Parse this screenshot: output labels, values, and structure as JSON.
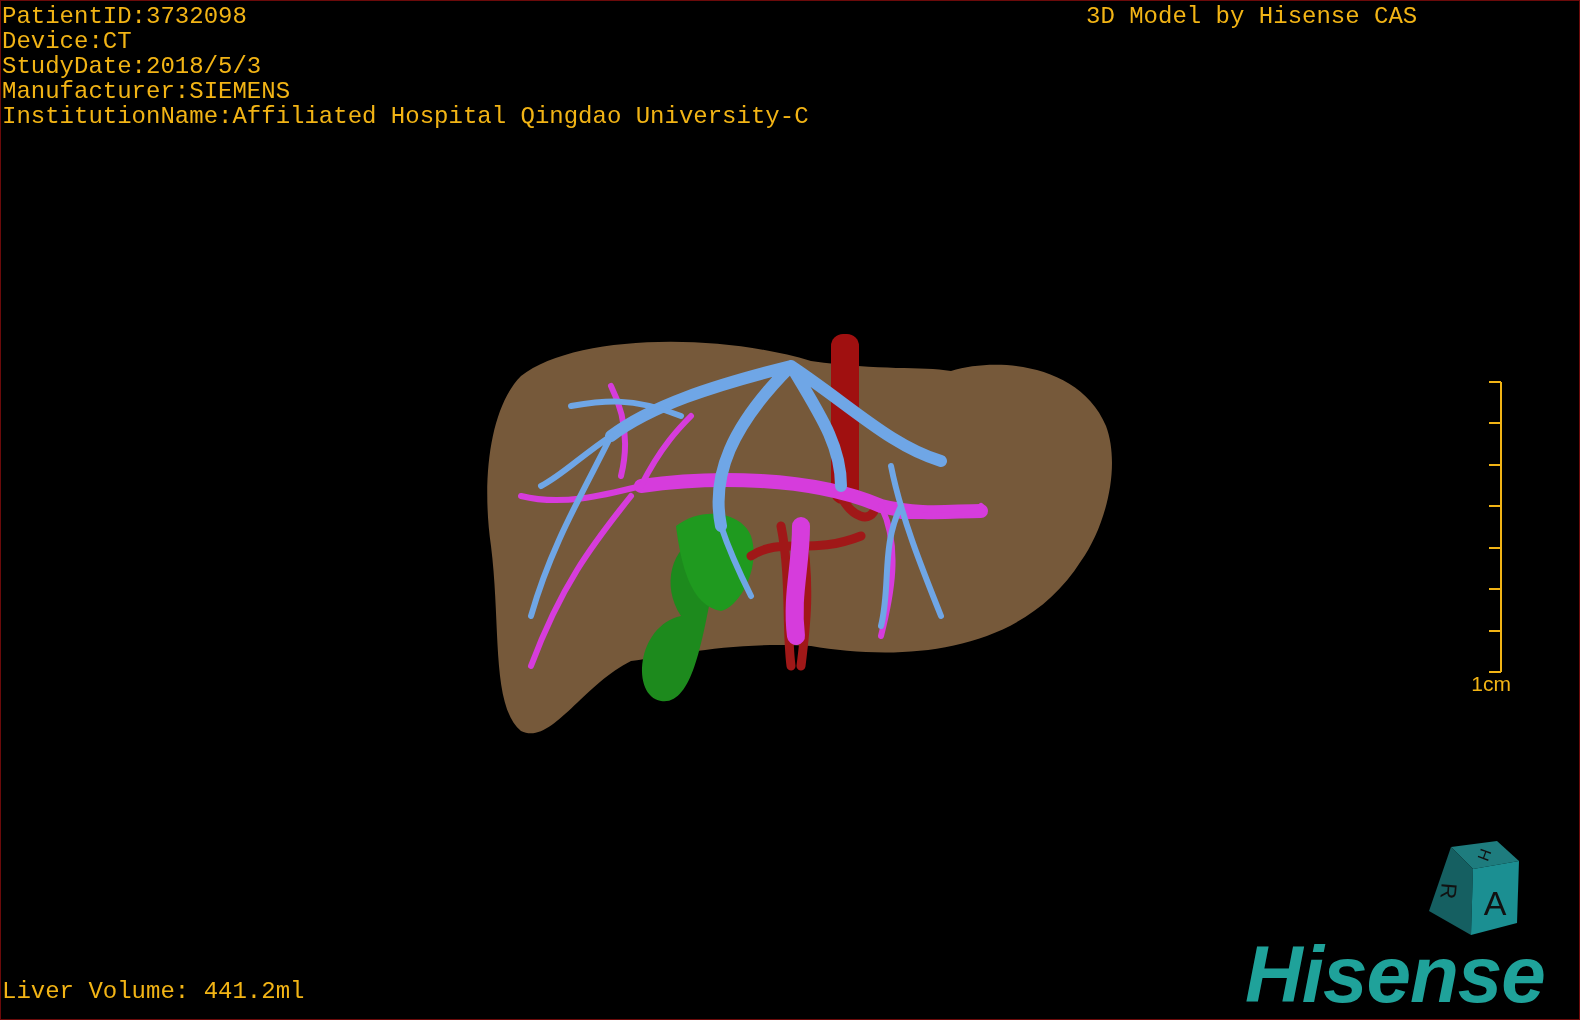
{
  "patient_info": [
    "PatientID:3732098",
    "Device:CT",
    "StudyDate:2018/5/3",
    "Manufacturer:SIEMENS",
    "InstitutionName:Affiliated Hospital Qingdao University-C"
  ],
  "model_credit": "3D Model by Hisense CAS",
  "scale_bar": {
    "label": "1cm"
  },
  "orientation_cube": {
    "top": "H",
    "left": "R",
    "front": "A"
  },
  "logo": "Hisense",
  "liver_volume": "Liver Volume: 441.2ml"
}
